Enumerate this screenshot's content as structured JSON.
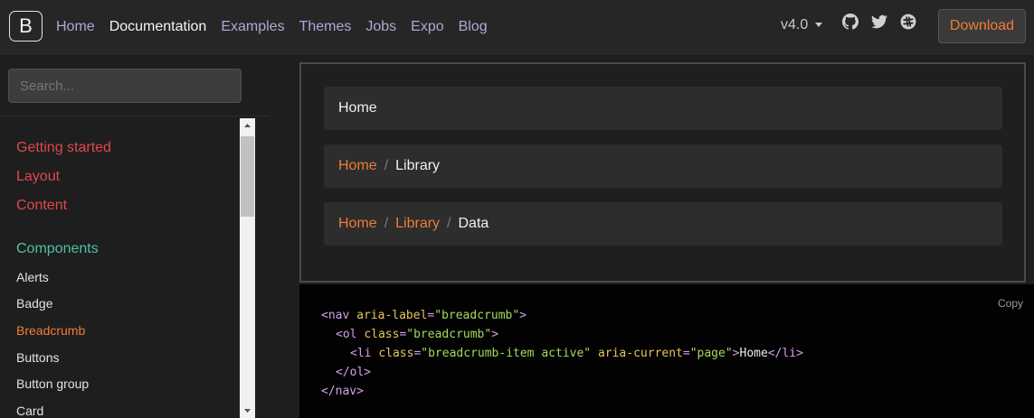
{
  "navbar": {
    "brand_letter": "B",
    "links": [
      {
        "label": "Home",
        "active": false
      },
      {
        "label": "Documentation",
        "active": true
      },
      {
        "label": "Examples",
        "active": false
      },
      {
        "label": "Themes",
        "active": false
      },
      {
        "label": "Jobs",
        "active": false
      },
      {
        "label": "Expo",
        "active": false
      },
      {
        "label": "Blog",
        "active": false
      }
    ],
    "version": "v4.0",
    "social_icons": [
      "github-icon",
      "twitter-icon",
      "slack-icon"
    ],
    "download_label": "Download"
  },
  "sidebar": {
    "search_placeholder": "Search...",
    "sections": [
      {
        "label": "Getting started"
      },
      {
        "label": "Layout"
      },
      {
        "label": "Content"
      }
    ],
    "components_label": "Components",
    "component_items": [
      {
        "label": "Alerts",
        "active": false
      },
      {
        "label": "Badge",
        "active": false
      },
      {
        "label": "Breadcrumb",
        "active": true
      },
      {
        "label": "Buttons",
        "active": false
      },
      {
        "label": "Button group",
        "active": false
      },
      {
        "label": "Card",
        "active": false
      }
    ]
  },
  "example": {
    "breadcrumbs": [
      {
        "items": [
          "Home"
        ]
      },
      {
        "items": [
          "Home",
          "Library"
        ]
      },
      {
        "items": [
          "Home",
          "Library",
          "Data"
        ]
      }
    ],
    "separator": "/"
  },
  "code": {
    "copy_label": "Copy",
    "lines": [
      [
        "<nav ",
        "aria-label",
        "=",
        "\"breadcrumb\"",
        ">"
      ],
      [
        "<ol ",
        "class",
        "=",
        "\"breadcrumb\"",
        ">"
      ],
      [
        "<li ",
        "class",
        "=",
        "\"breadcrumb-item active\"",
        " ",
        "aria-current",
        "=",
        "\"page\"",
        ">",
        "Home",
        "</li>"
      ],
      [
        "</ol>"
      ],
      [
        "</nav>"
      ]
    ]
  },
  "colors": {
    "accent_orange": "#ee7d37",
    "section_red": "#e0474c",
    "components_teal": "#4fc1a6",
    "nav_link_purple": "#b3a5d8"
  }
}
